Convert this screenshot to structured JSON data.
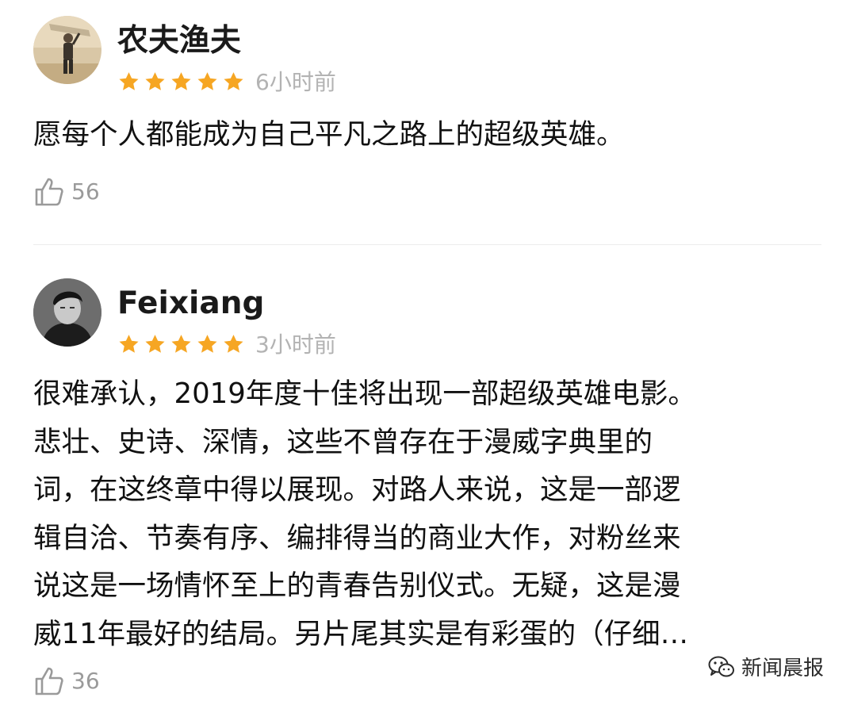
{
  "comments": [
    {
      "username": "农夫渔夫",
      "rating": 5,
      "time": "6小时前",
      "lines": [
        "愿每个人都能成为自己平凡之路上的超级英雄。"
      ],
      "likes": "56"
    },
    {
      "username": "Feixiang",
      "rating": 5,
      "time": "3小时前",
      "lines": [
        "很难承认，2019年度十佳将出现一部超级英雄电影。",
        "悲壮、史诗、深情，这些不曾存在于漫威字典里的",
        "词，在这终章中得以展现。对路人来说，这是一部逻",
        "辑自洽、节奏有序、编排得当的商业大作，对粉丝来",
        "说这是一场情怀至上的青春告别仪式。无疑，这是漫",
        "威11年最好的结局。另片尾其实是有彩蛋的（仔细…"
      ],
      "likes": "36"
    }
  ],
  "watermark": {
    "text": "新闻晨报",
    "icon": "wechat-icon"
  },
  "colors": {
    "star": "#f6a623",
    "time": "#b3b3b3",
    "like": "#9a9a9a",
    "text": "#111111"
  }
}
